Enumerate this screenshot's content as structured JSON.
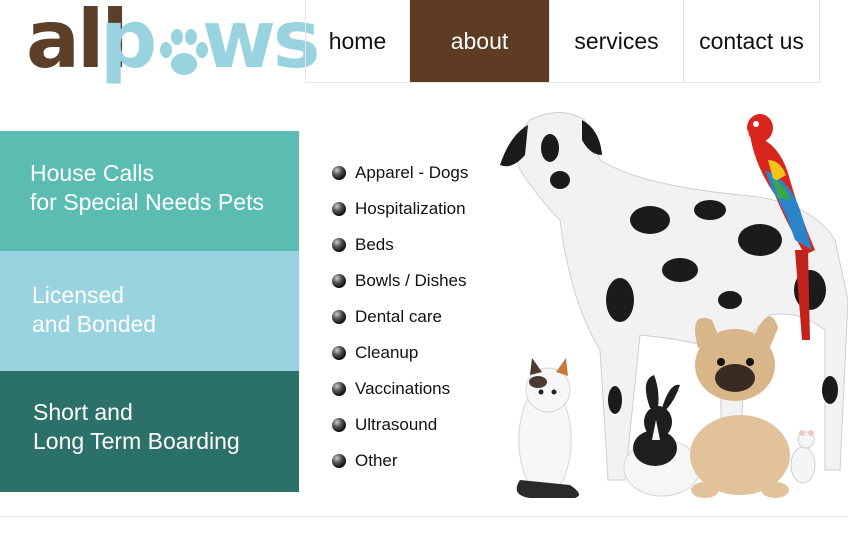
{
  "logo": {
    "part1": "all",
    "part2": "p",
    "part3": "ws",
    "brand_color": "#5b3f28",
    "accent_color": "#99d3e0"
  },
  "nav": {
    "items": [
      {
        "label": "home",
        "active": false
      },
      {
        "label": "about",
        "active": true
      },
      {
        "label": "services",
        "active": false
      },
      {
        "label": "contact us",
        "active": false
      }
    ],
    "active_color": "#5e3c24"
  },
  "panels": [
    {
      "line1": "House Calls",
      "line2": "for Special Needs Pets",
      "color": "#5bbdb2"
    },
    {
      "line1": "Licensed",
      "line2": "and Bonded",
      "color": "#99d3e0"
    },
    {
      "line1": "Short and",
      "line2": "Long Term Boarding",
      "color": "#2c7169"
    }
  ],
  "services": [
    "Apparel - Dogs",
    "Hospitalization",
    "Beds",
    "Bowls / Dishes",
    "Dental care",
    "Cleanup",
    "Vaccinations",
    "Ultrasound",
    "Other"
  ],
  "icons": {
    "bullet": "bullet-icon",
    "paw": "paw-icon"
  }
}
